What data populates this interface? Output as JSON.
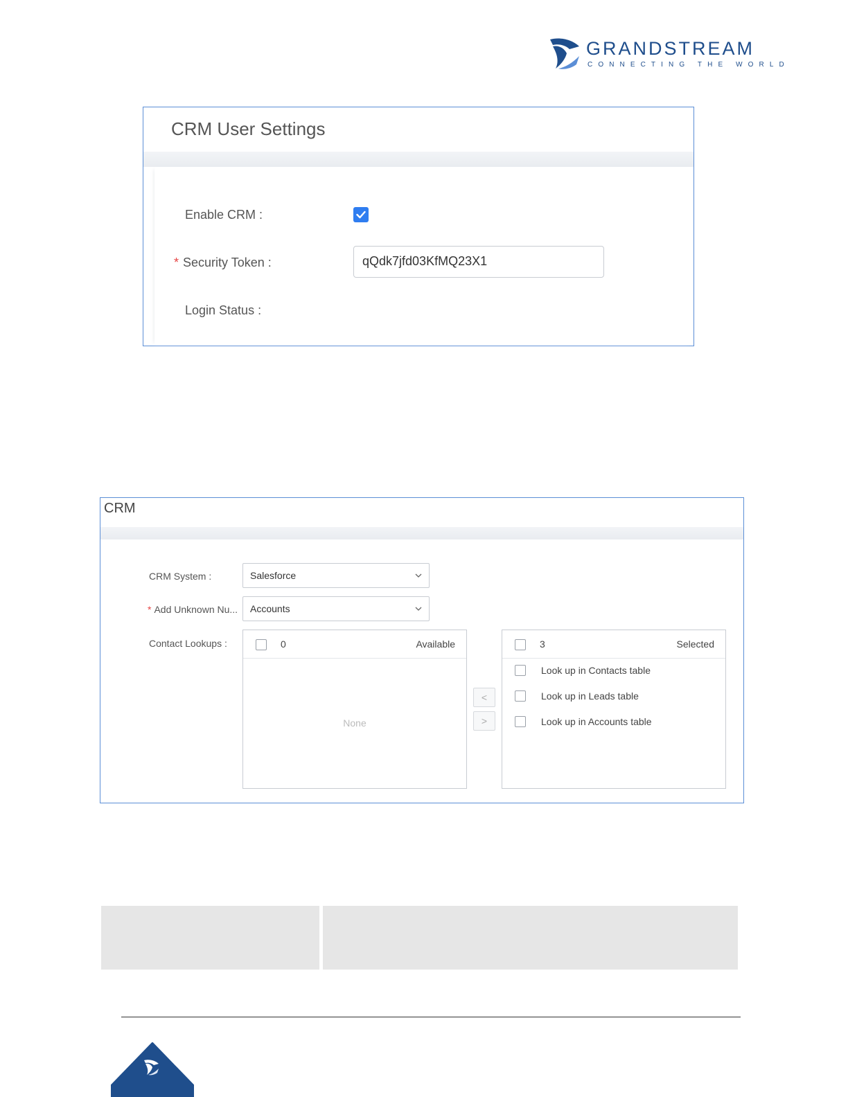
{
  "header": {
    "brand_name": "GRANDSTREAM",
    "brand_tagline": "CONNECTING THE WORLD",
    "brand_color": "#1f4e8c"
  },
  "crm_user_settings": {
    "title": "CRM User Settings",
    "enable_crm_label": "Enable CRM :",
    "enable_crm_checked": true,
    "security_token_label": "Security Token :",
    "security_token_value": "qQdk7jfd03KfMQ23X1",
    "login_status_label": "Login Status :",
    "required_marker": "*",
    "accent_color": "#2f7df0"
  },
  "crm": {
    "title": "CRM",
    "crm_system_label": "CRM System :",
    "crm_system_value": "Salesforce",
    "add_unknown_label": "Add Unknown Nu...",
    "add_unknown_value": "Accounts",
    "required_marker": "*",
    "contact_lookups_label": "Contact Lookups :",
    "available": {
      "count": "0",
      "title": "Available",
      "empty_text": "None"
    },
    "selected": {
      "count": "3",
      "title": "Selected",
      "items": [
        "Look up in Contacts table",
        "Look up in Leads table",
        "Look up in Accounts table"
      ]
    },
    "move_left_glyph": "<",
    "move_right_glyph": ">"
  }
}
